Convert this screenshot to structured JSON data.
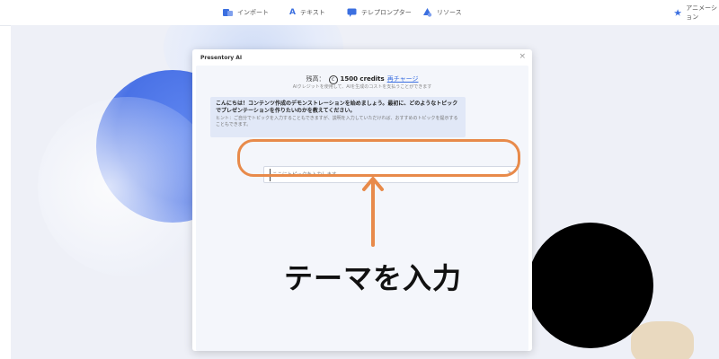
{
  "toolbar": {
    "items": [
      {
        "label": "インポート",
        "icon": "import-icon"
      },
      {
        "label": "テキスト",
        "icon": "text-icon"
      },
      {
        "label": "テレプロンプター",
        "icon": "teleprompter-icon"
      },
      {
        "label": "リソース",
        "icon": "resources-icon"
      },
      {
        "label": "アニメーション",
        "icon": "animation-icon"
      }
    ]
  },
  "dialog": {
    "title": "Presentory AI",
    "close_icon": "close-icon",
    "balance_label": "残高：",
    "credits": "1500 credits",
    "recharge": "再チャージ",
    "credits_note": "AIクレジットを使用して、AIを生成のコストを支払うことができます",
    "message": {
      "main": "こんにちは！コンテンツ作成のデモンストレーションを始めましょう。最初に、どのようなトピックでプレゼンテーションを作りたいのかを教えてください。",
      "hint": "ヒント：ご自分でトピックを入力することもできますが、説明を入力していただければ、おすすめのトピックを提示することもできます。"
    },
    "input": {
      "placeholder": "ここにトピックを入力します",
      "value": ""
    },
    "send_icon": "send-icon"
  },
  "annotation": {
    "text": "テーマを入力",
    "color": "#e88a4a"
  },
  "colors": {
    "accent": "#3b6fe0",
    "highlight": "#e88a4a"
  }
}
